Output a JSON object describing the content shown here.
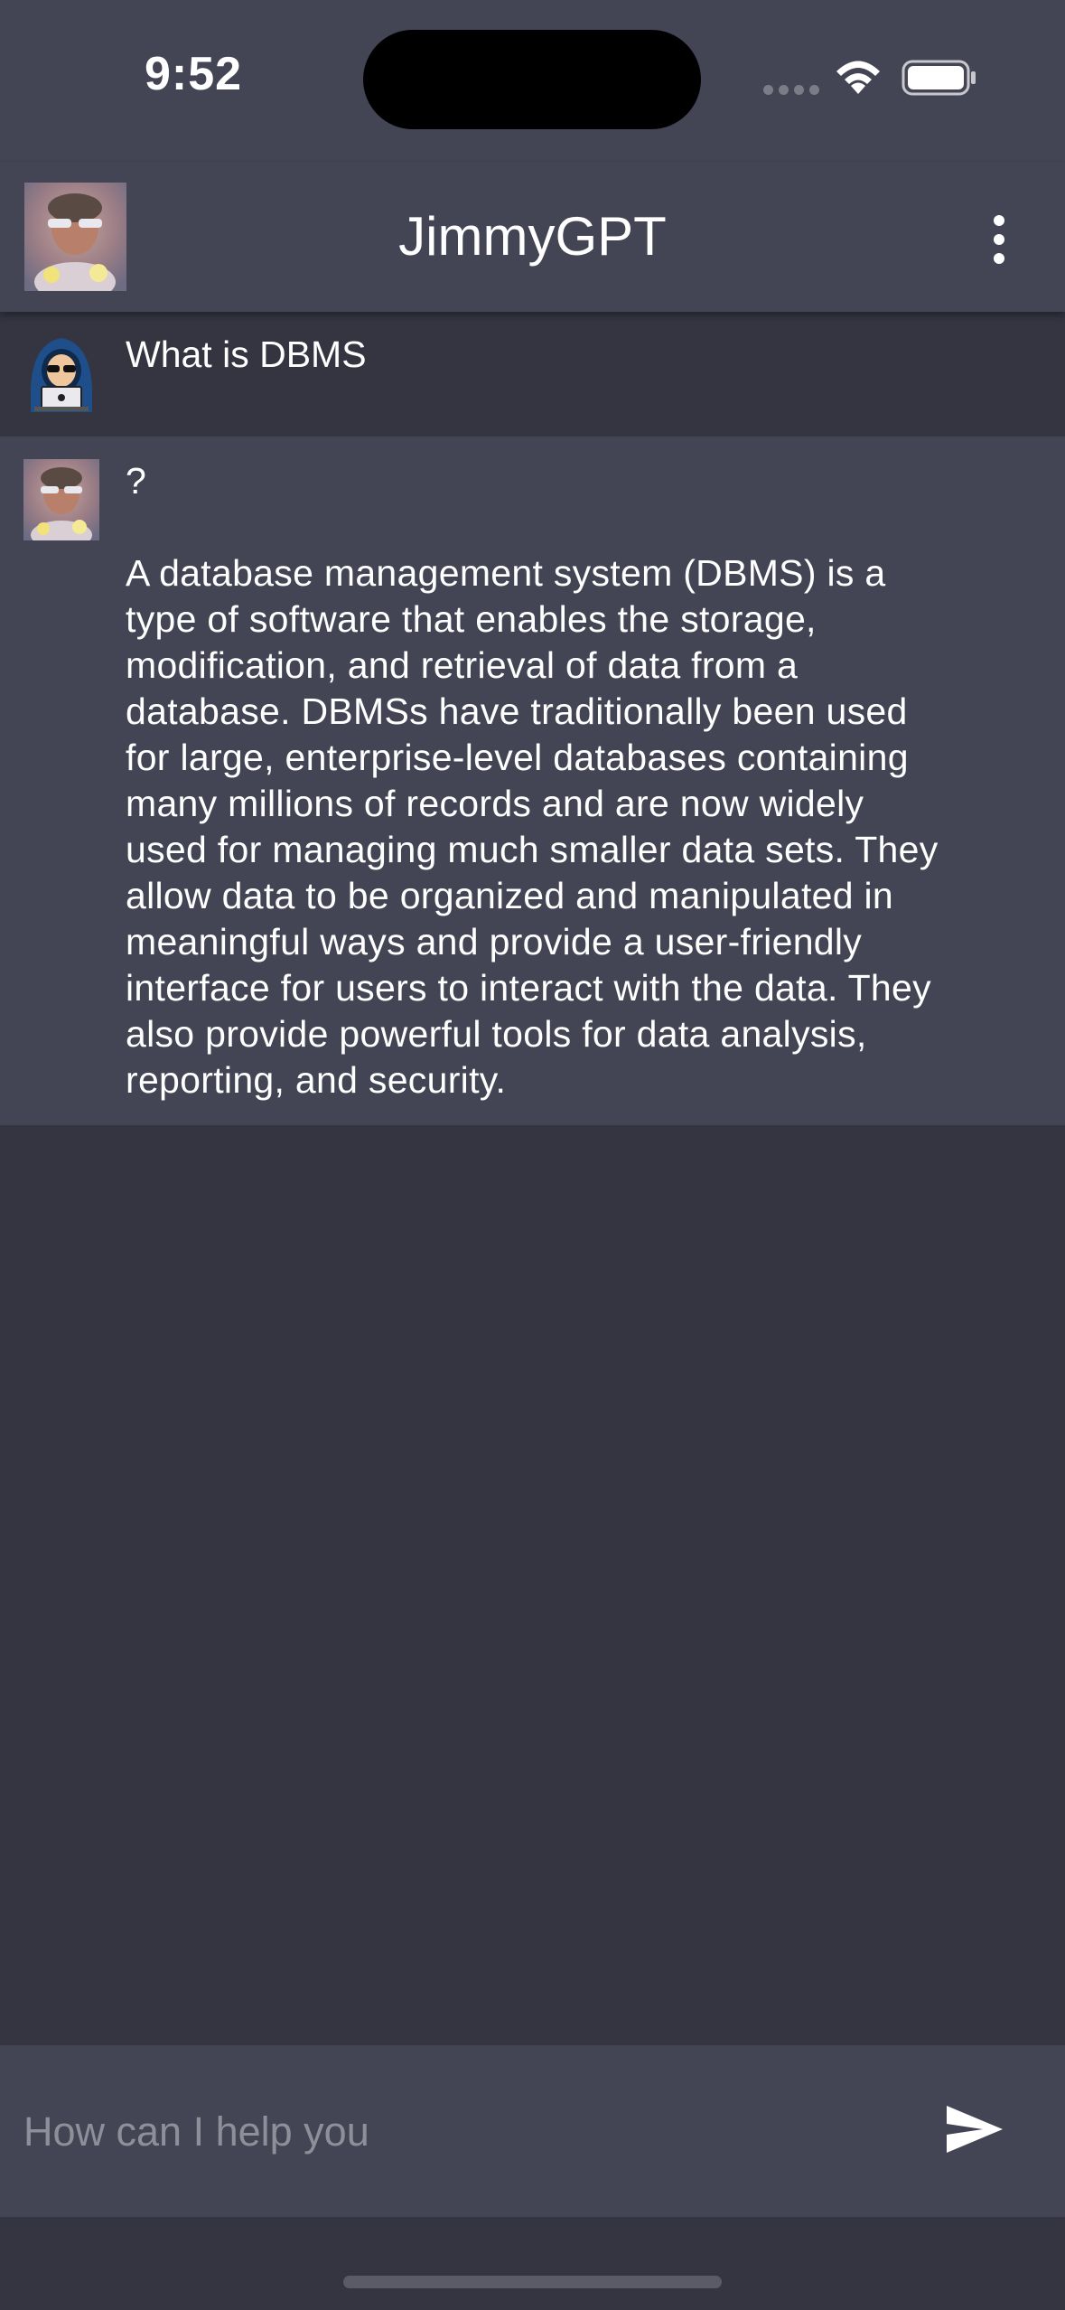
{
  "status_bar": {
    "time": "9:52"
  },
  "header": {
    "title": "JimmyGPT",
    "avatar_icon": "user-photo-avatar",
    "menu_icon": "more-vertical-icon"
  },
  "conversation": {
    "user_message": {
      "avatar_icon": "hooded-hacker-avatar",
      "text": "What is DBMS"
    },
    "bot_message": {
      "avatar_icon": "user-photo-avatar",
      "question_mark": "?",
      "text": "A database management system (DBMS) is a\ntype of software that enables the storage,\nmodification, and retrieval of data from a\ndatabase. DBMSs have traditionally been used\nfor large, enterprise-level databases containing\nmany millions of records and are now widely\nused for managing much smaller data sets. They\nallow data to be organized and manipulated in\nmeaningful ways and provide a user-friendly\ninterface for users to interact with the data. They\nalso provide powerful tools for data analysis,\nreporting, and security."
    }
  },
  "input": {
    "placeholder": "How can I help you",
    "value": "",
    "send_icon": "send-icon"
  },
  "colors": {
    "background": "#353542",
    "panel": "#444554",
    "user_row": "#343541",
    "text": "#ffffff",
    "placeholder": "#8e8f99"
  }
}
